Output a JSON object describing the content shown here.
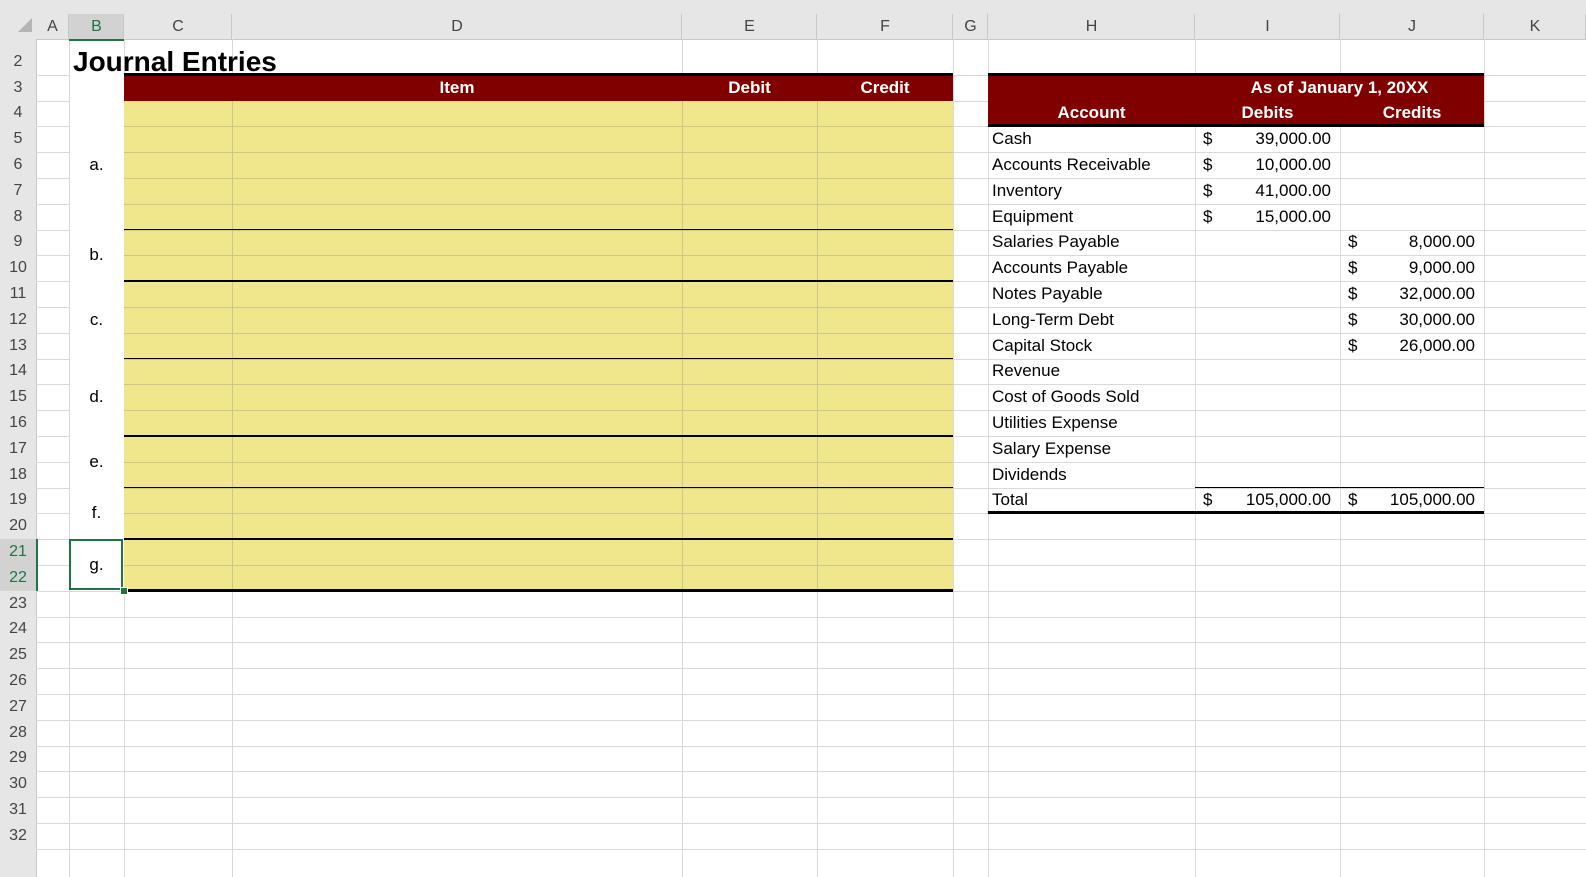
{
  "column_headers": [
    "A",
    "B",
    "C",
    "D",
    "E",
    "F",
    "G",
    "H",
    "I",
    "J",
    "K"
  ],
  "row_numbers": [
    "2",
    "3",
    "4",
    "5",
    "6",
    "7",
    "8",
    "9",
    "10",
    "11",
    "12",
    "13",
    "14",
    "15",
    "16",
    "17",
    "18",
    "19",
    "20",
    "21",
    "22",
    "23",
    "24",
    "25",
    "26",
    "27",
    "28",
    "29",
    "30",
    "31",
    "32"
  ],
  "journal": {
    "title": "Journal Entries",
    "headers": {
      "item": "Item",
      "debit": "Debit",
      "credit": "Credit"
    },
    "entries": [
      {
        "label": "a."
      },
      {
        "label": "b."
      },
      {
        "label": "c."
      },
      {
        "label": "d."
      },
      {
        "label": "e."
      },
      {
        "label": "f."
      },
      {
        "label": "g."
      }
    ]
  },
  "trial_balance": {
    "date_header": "As of January 1, 20XX",
    "headers": {
      "account": "Account",
      "debits": "Debits",
      "credits": "Credits"
    },
    "currency": "$",
    "rows": [
      {
        "account": "Cash",
        "debit": "39,000.00",
        "credit": ""
      },
      {
        "account": "Accounts Receivable",
        "debit": "10,000.00",
        "credit": ""
      },
      {
        "account": "Inventory",
        "debit": "41,000.00",
        "credit": ""
      },
      {
        "account": "Equipment",
        "debit": "15,000.00",
        "credit": ""
      },
      {
        "account": "Salaries Payable",
        "debit": "",
        "credit": "8,000.00"
      },
      {
        "account": "Accounts Payable",
        "debit": "",
        "credit": "9,000.00"
      },
      {
        "account": "Notes Payable",
        "debit": "",
        "credit": "32,000.00"
      },
      {
        "account": "Long-Term Debt",
        "debit": "",
        "credit": "30,000.00"
      },
      {
        "account": "Capital Stock",
        "debit": "",
        "credit": "26,000.00"
      },
      {
        "account": "Revenue",
        "debit": "",
        "credit": ""
      },
      {
        "account": "Cost of Goods Sold",
        "debit": "",
        "credit": ""
      },
      {
        "account": "Utilities Expense",
        "debit": "",
        "credit": ""
      },
      {
        "account": "Salary Expense",
        "debit": "",
        "credit": ""
      },
      {
        "account": "Dividends",
        "debit": "",
        "credit": ""
      }
    ],
    "total": {
      "label": "Total",
      "debit": "105,000.00",
      "credit": "105,000.00"
    }
  },
  "colors": {
    "header_band": "#800000",
    "entry_fill": "#f0e68c",
    "selection": "#217346"
  }
}
